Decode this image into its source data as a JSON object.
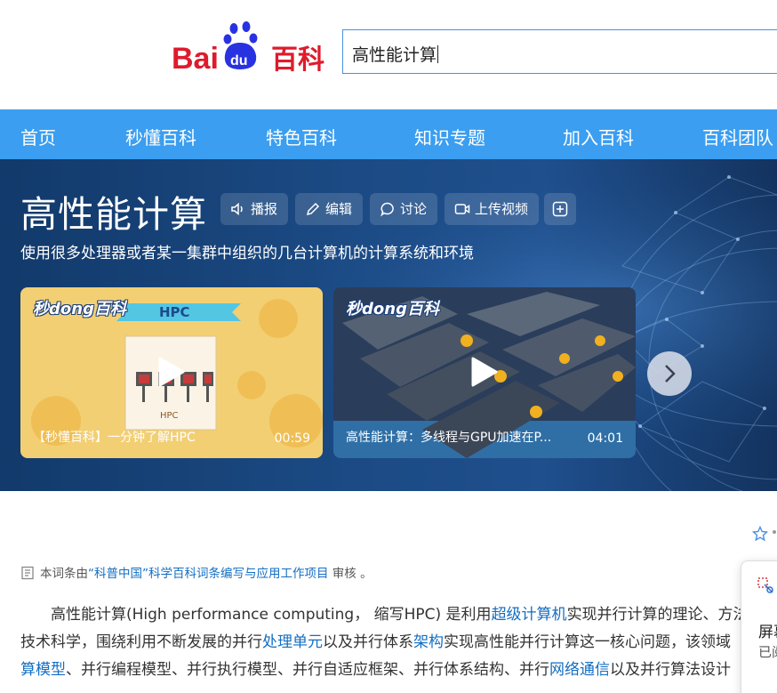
{
  "header": {
    "logo_alt": "Baidu百科",
    "search_value": "高性能计算"
  },
  "nav": [
    "首页",
    "秒懂百科",
    "特色百科",
    "知识专题",
    "加入百科",
    "百科团队"
  ],
  "hero": {
    "title": "高性能计算",
    "actions": [
      {
        "label": "播报",
        "icon": "speaker-icon"
      },
      {
        "label": "编辑",
        "icon": "pencil-icon"
      },
      {
        "label": "讨论",
        "icon": "chat-bubble-icon"
      },
      {
        "label": "上传视频",
        "icon": "video-camera-icon"
      }
    ],
    "add_icon": "plus-square-icon",
    "subtitle": "使用很多处理器或者某一集群中组织的几台计算机的计算系统和环境",
    "videos": [
      {
        "brand": "秒dong百科",
        "title": "【秒懂百科】一分钟了解HPC",
        "duration": "00:59",
        "banner": "HPC",
        "caption": "HPC"
      },
      {
        "brand": "秒dong百科",
        "title": "高性能计算：多线程与GPU加速在P...",
        "duration": "04:01"
      }
    ]
  },
  "article": {
    "review_prefix": "本词条由",
    "review_link": "“科普中国”科学百科词条编写与应用工作项目",
    "review_suffix": " 审核 。",
    "lines": [
      [
        {
          "t": "高性能计算(High performance computing， 缩写HPC) 是利用"
        },
        {
          "t": "超级计算机",
          "link": true
        },
        {
          "t": "实现并行计算的理论、方法、"
        }
      ],
      [
        {
          "t": "技术科学，围绕利用不断发展的并行"
        },
        {
          "t": "处理单元",
          "link": true
        },
        {
          "t": "以及并行体系"
        },
        {
          "t": "架构",
          "link": true
        },
        {
          "t": "实现高性能并行计算这一核心问题，该领域"
        }
      ],
      [
        {
          "t": "算模型",
          "link": true
        },
        {
          "t": "、并行编程模型、并行执行模型、并行自适应框架、并行体系结构、并行"
        },
        {
          "t": "网络通信",
          "link": true
        },
        {
          "t": "以及并行算法设计"
        }
      ]
    ]
  },
  "side_popup": {
    "line1": "屏幕",
    "line2": "已阅"
  },
  "colors": {
    "nav_bg": "#3b9ef0",
    "link": "#136ec2",
    "baidu_red": "#de1b2c",
    "baidu_blue": "#2932e1"
  }
}
